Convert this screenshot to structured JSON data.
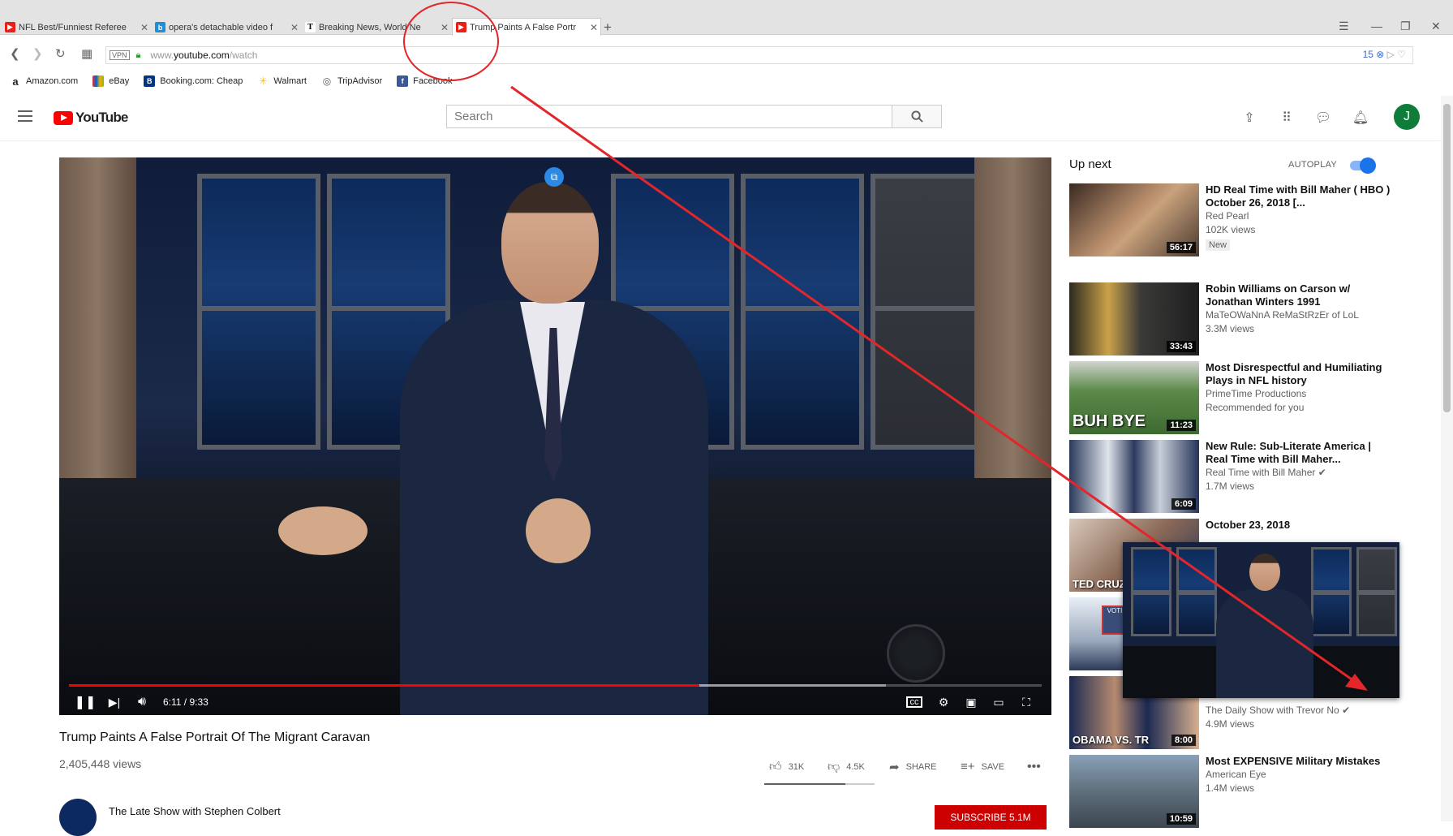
{
  "browser": {
    "tabs": [
      {
        "title": "NFL Best/Funniest Referee",
        "icon_color": "#e62117"
      },
      {
        "title": "opera's detachable video f",
        "icon_color": "#1f8fd8",
        "icon_char": "b"
      },
      {
        "title": "Breaking News, World Ne",
        "icon_color": "#222222",
        "icon_char": "T"
      },
      {
        "title": "Trump Paints A False Portr",
        "icon_color": "#e62117"
      }
    ],
    "url_domain": "www.youtube.com",
    "url_path": "/watch",
    "vpn_label": "VPN",
    "badge_count": "15",
    "bookmarks": [
      {
        "label": "Amazon.com",
        "icon": "amazon-icon",
        "color": "#222222",
        "char": "a"
      },
      {
        "label": "eBay",
        "icon": "ebay-icon",
        "color": "#e53238",
        "char": ""
      },
      {
        "label": "Booking.com: Cheap",
        "icon": "booking-icon",
        "color": "#003580",
        "char": "B."
      },
      {
        "label": "Walmart",
        "icon": "walmart-icon",
        "color": "#ffc220",
        "char": "✳"
      },
      {
        "label": "TripAdvisor",
        "icon": "tripadvisor-icon",
        "color": "#555555",
        "char": "◎"
      },
      {
        "label": "Facebook",
        "icon": "facebook-icon",
        "color": "#3b5998",
        "char": "f"
      }
    ]
  },
  "youtube": {
    "logo_text": "YouTube",
    "search_placeholder": "Search",
    "avatar_letter": "J"
  },
  "player": {
    "time": "6:11 / 9:33",
    "progress": 0.648,
    "buffered": 0.84
  },
  "video": {
    "title": "Trump Paints A False Portrait Of The Migrant Caravan",
    "views": "2,405,448 views",
    "likes": "31K",
    "dislikes": "4.5K",
    "share_label": "SHARE",
    "save_label": "SAVE",
    "channel": "The Late Show with Stephen Colbert",
    "subscribe_label": "SUBSCRIBE 5.1M"
  },
  "sidebar": {
    "up_next": "Up next",
    "autoplay_label": "AUTOPLAY",
    "autoplay_on": true,
    "recommendations": [
      {
        "title": "HD Real Time with Bill Maher ( HBO ) October 26, 2018 [...",
        "channel": "Red Pearl",
        "views": "102K views",
        "badge": "New",
        "duration": "56:17",
        "caption": ""
      },
      {
        "title": "Robin Williams on Carson w/ Jonathan Winters 1991",
        "channel": "MaTeOWaNnA ReMaStRzEr of LoL",
        "views": "3.3M views",
        "badge": "",
        "duration": "33:43",
        "caption": ""
      },
      {
        "title": "Most Disrespectful and Humiliating Plays in NFL history",
        "channel": "PrimeTime Productions",
        "views": "Recommended for you",
        "badge": "",
        "duration": "11:23",
        "caption": "BUH BYE"
      },
      {
        "title": "New Rule: Sub-Literate America | Real Time with Bill Maher...",
        "channel": "Real Time with Bill Maher",
        "views": "1.7M views",
        "badge": "",
        "duration": "6:09",
        "caption": ""
      },
      {
        "title": "October 23, 2018",
        "channel": "",
        "views": "",
        "badge": "",
        "duration": "",
        "caption": "TED CRUZ"
      },
      {
        "title": "",
        "channel": "",
        "views": "",
        "badge": "",
        "duration": "",
        "caption": ""
      },
      {
        "title": "",
        "channel": "The Daily Show with Trevor No",
        "views": "4.9M views",
        "badge": "",
        "duration": "8:00",
        "caption": "OBAMA VS. TR"
      },
      {
        "title": "Most EXPENSIVE Military Mistakes",
        "channel": "American Eye",
        "views": "1.4M views",
        "badge": "",
        "duration": "10:59",
        "caption": ""
      }
    ]
  },
  "colors": {
    "accent_red": "#ff0000",
    "annotation_red": "#e3262a",
    "toggle_blue": "#1a73e8"
  }
}
